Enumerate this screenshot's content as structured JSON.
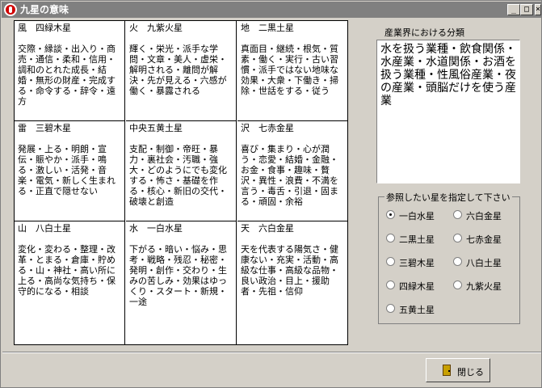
{
  "window": {
    "title": "九星の意味",
    "min_label": "_",
    "max_label": "□",
    "close_label": "×"
  },
  "stars": [
    {
      "name": "風　四緑木星",
      "desc": "交際・縁談・出入り・商売・通信・柔和・信用・調和のとれた成長・結婚・無形の財産・完成する・命令する・辞令・遠方"
    },
    {
      "name": "火　九紫火星",
      "desc": "輝く・栄光・派手な学問・文章・美人・虚栄・解明される・離問が解決・先が見える・六感が働く・暴露される"
    },
    {
      "name": "地　二黒土星",
      "desc": "真面目・継続・根気・質素・働く・実行・古い習慣・派手ではない地味な効果・大衆・下働き・掃除・世話をする・従う"
    },
    {
      "name": "雷　三碧木星",
      "desc": "発展・上る・明朗・宣伝・賑やか・派手・鳴る・激しい・活発・音楽・電気・新しく生まれる・正直で隠せない"
    },
    {
      "name": "中央五黄土星",
      "desc": "支配・制御・帝旺・暴力・裏社会・汚職・強大・どのようにでも変化する・怖さ・基礎を作る・核心・新旧の交代・破壊と創造"
    },
    {
      "name": "沢　七赤金星",
      "desc": "喜び・集まり・心が潤う・恋愛・結婚・金融・お金・食事・趣味・贅沢・異性・浪費・不満を言う・毒舌・引退・固まる・頑固・余裕"
    },
    {
      "name": "山　八白土星",
      "desc": "変化・変わる・整理・改革・とまる・倉庫・貯める・山・神社・高い所に上る・高尚な気持ち・保守的になる・相談"
    },
    {
      "name": "水　一白水星",
      "desc": "下がる・暗い・悩み・思考・戦略・残忍・秘密・発明・創作・交わり・生みの苦しみ・効果はゆっくり・スタート・新規・一途"
    },
    {
      "name": "天　六白金星",
      "desc": "天を代表する陽気さ・健康ない・充実・活動・高級な仕事・高級な品物・良い政治・目上・援助者・先祖・信仰"
    }
  ],
  "industry": {
    "label": "産業界における分類",
    "text": "水を扱う業種・飲食関係・水産業・水道関係・お酒を扱う業種・性風俗産業・夜の産業・頭脳だけを使う産業"
  },
  "selector": {
    "label": "参照したい星を指定して下さい",
    "options": [
      {
        "label": "一白水星",
        "checked": true
      },
      {
        "label": "六白金星",
        "checked": false
      },
      {
        "label": "二黒土星",
        "checked": false
      },
      {
        "label": "七赤金星",
        "checked": false
      },
      {
        "label": "三碧木星",
        "checked": false
      },
      {
        "label": "八白土星",
        "checked": false
      },
      {
        "label": "四緑木星",
        "checked": false
      },
      {
        "label": "九紫火星",
        "checked": false
      },
      {
        "label": "五黄土星",
        "checked": false
      }
    ]
  },
  "close_button": {
    "label": "閉じる",
    "icon": "door-icon"
  }
}
